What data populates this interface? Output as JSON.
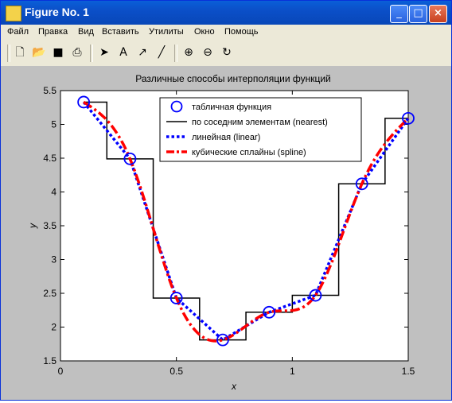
{
  "window": {
    "title": "Figure No. 1"
  },
  "menu": [
    "Файл",
    "Правка",
    "Вид",
    "Вставить",
    "Утилиты",
    "Окно",
    "Помощь"
  ],
  "toolbar": {
    "icons": [
      "new-file-icon",
      "open-folder-icon",
      "save-icon",
      "print-icon",
      "pointer-arrow-icon",
      "text-a-icon",
      "arrow-icon",
      "line-icon",
      "zoom-in-icon",
      "zoom-out-icon",
      "rotate-icon"
    ]
  },
  "chart_data": {
    "type": "line",
    "title": "Различные способы интерполяции функций",
    "xlabel": "x",
    "ylabel": "y",
    "xlim": [
      0,
      1.5
    ],
    "ylim": [
      1.5,
      5.5
    ],
    "xticks": [
      "0",
      "0.5",
      "1",
      "1.5"
    ],
    "yticks": [
      "1.5",
      "2",
      "2.5",
      "3",
      "3.5",
      "4",
      "4.5",
      "5",
      "5.5"
    ],
    "legend_position": "top-right",
    "series": [
      {
        "name": "табличная функция",
        "style": "markers",
        "color": "#0000ff",
        "x": [
          0.1,
          0.3,
          0.5,
          0.7,
          0.9,
          1.1,
          1.3,
          1.5
        ],
        "y": [
          5.33,
          4.49,
          2.43,
          1.81,
          2.22,
          2.47,
          4.12,
          5.09
        ]
      },
      {
        "name": "по соседним элементам (nearest)",
        "style": "step",
        "color": "#000000",
        "x": [
          0.1,
          0.3,
          0.5,
          0.7,
          0.9,
          1.1,
          1.3,
          1.5
        ],
        "y": [
          5.33,
          4.49,
          2.43,
          1.81,
          2.22,
          2.47,
          4.12,
          5.09
        ]
      },
      {
        "name": "линейная (linear)",
        "style": "dotted",
        "color": "#0000ff",
        "x": [
          0.1,
          0.3,
          0.5,
          0.7,
          0.9,
          1.1,
          1.3,
          1.5
        ],
        "y": [
          5.33,
          4.49,
          2.43,
          1.81,
          2.22,
          2.47,
          4.12,
          5.09
        ]
      },
      {
        "name": "кубические сплайны (spline)",
        "style": "dashdot",
        "color": "#ff0000",
        "x": [
          0.1,
          0.3,
          0.5,
          0.7,
          0.9,
          1.1,
          1.3,
          1.5
        ],
        "y": [
          5.33,
          4.49,
          2.43,
          1.81,
          2.22,
          2.47,
          4.12,
          5.09
        ]
      }
    ]
  }
}
